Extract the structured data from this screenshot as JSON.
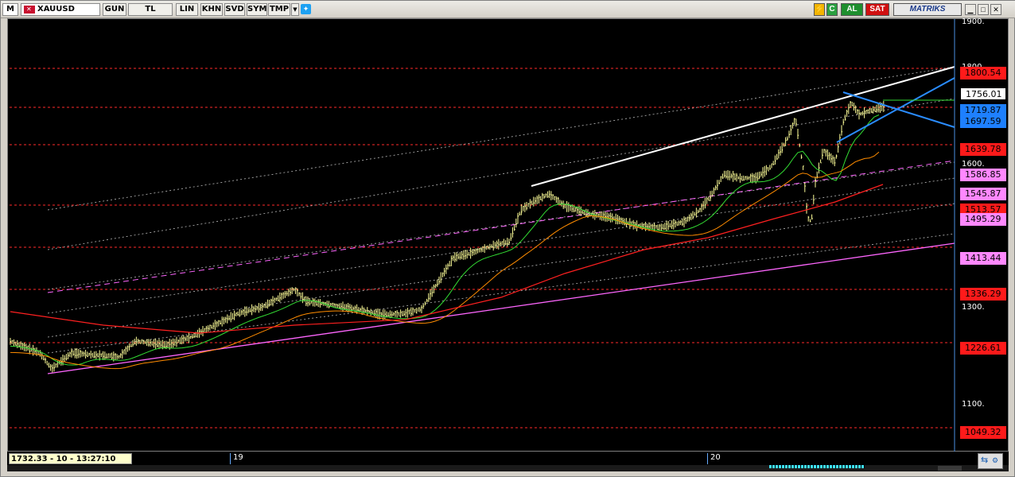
{
  "toolbar": {
    "logo": "M",
    "symbol": "XAUUSD",
    "buttons": [
      "GUN",
      "TL",
      "LIN",
      "KHN",
      "SVD",
      "SYM",
      "TMP"
    ],
    "buy_label": "AL",
    "sell_label": "SAT",
    "brand": "MATRIKS"
  },
  "colors": {
    "background": "#000000",
    "candle": "#ffff99",
    "ma_short": "#33dd33",
    "ma_mid": "#ff8c00",
    "ma_long": "#ff2020",
    "support_line": "#ff66ff",
    "resistance_line": "#ffffff",
    "triangle_lines": "#2a8cff",
    "level_lines": "#ff2a2a"
  },
  "chart": {
    "price_tags": [
      {
        "value": "1800.54",
        "style": "red"
      },
      {
        "value": "1756.01",
        "style": "white"
      },
      {
        "value": "1719.87",
        "style": "blue"
      },
      {
        "value": "1697.59",
        "style": "blue"
      },
      {
        "value": "1639.78",
        "style": "red"
      },
      {
        "value": "1586.85",
        "style": "pink"
      },
      {
        "value": "1545.87",
        "style": "pink"
      },
      {
        "value": "1513.57",
        "style": "red"
      },
      {
        "value": "1495.29",
        "style": "pink"
      },
      {
        "value": "1413.44",
        "style": "pink"
      },
      {
        "value": "1336.29",
        "style": "red"
      },
      {
        "value": "1226.61",
        "style": "red"
      },
      {
        "value": "1049.32",
        "style": "red"
      }
    ],
    "axis_labels": [
      "1900.",
      "1800.",
      "1600.",
      "1300.",
      "1100."
    ],
    "x_labels": [
      "19",
      "20"
    ],
    "status": "1732.33 - 10 - 13:27:10"
  }
}
